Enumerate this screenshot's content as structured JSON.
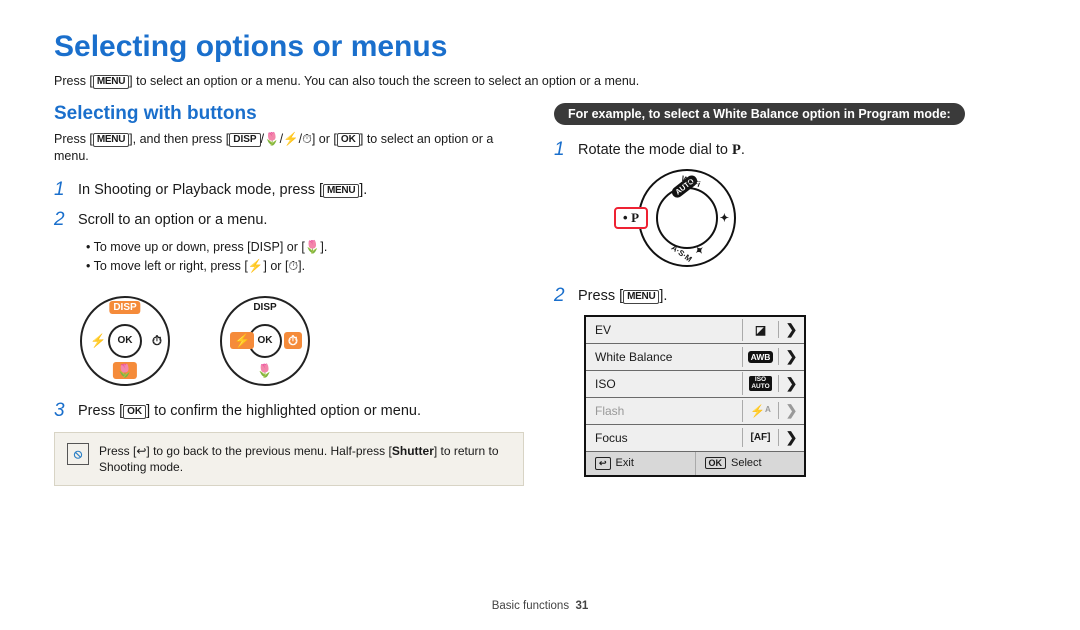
{
  "title": "Selecting options or menus",
  "intro_pre": "Press [",
  "intro_post": "] to select an option or a menu. You can also touch the screen to select an option or a menu.",
  "left": {
    "section_title": "Selecting with buttons",
    "sub_pre": "Press [",
    "sub_mid1": "], and then press [",
    "sub_mid2": "/🌷/⚡/⏱] or [",
    "sub_post": "] to select an option or a menu.",
    "step1_pre": "In Shooting or Playback mode, press [",
    "step1_post": "].",
    "step2": "Scroll to an option or a menu.",
    "bullets": [
      "To move up or down, press [DISP] or [🌷].",
      "To move left or right, press [⚡] or [⏱]."
    ],
    "dpad": {
      "top": "DISP",
      "left": "⚡",
      "right": "⏱",
      "bottom": "🌷",
      "ok": "OK"
    },
    "step3_pre": "Press [",
    "step3_post": "] to confirm the highlighted option or menu.",
    "note_pre": "Press [↩] to go back to the previous menu. Half-press [",
    "note_bold": "Shutter",
    "note_post": "] to return to Shooting mode."
  },
  "right": {
    "example_bar": "For example, to select a White Balance option in Program mode:",
    "step1_pre": "Rotate the mode dial to ",
    "step1_mode": "P",
    "step1_post": ".",
    "dial": {
      "auto": "AUTO",
      "wifi": "Wi-Fi",
      "asm": "A·S·M",
      "p": "P"
    },
    "step2_pre": "Press [",
    "step2_post": "].",
    "menu": {
      "rows": [
        {
          "label": "EV",
          "icon": "◪",
          "dim": false
        },
        {
          "label": "White Balance",
          "icon": "AWB",
          "dim": false,
          "dark": true
        },
        {
          "label": "ISO",
          "icon": "ISO\nAUTO",
          "dim": false,
          "dark": true,
          "small": true
        },
        {
          "label": "Flash",
          "icon": "⚡ᴬ",
          "dim": true
        },
        {
          "label": "Focus",
          "icon": "[AF]",
          "dim": false
        }
      ],
      "footer_exit": "Exit",
      "footer_select": "Select",
      "footer_exit_key": "↩",
      "footer_select_key": "OK"
    }
  },
  "labels": {
    "menu": "MENU",
    "disp": "DISP",
    "ok": "OK"
  },
  "footer": {
    "section": "Basic functions",
    "page": "31"
  }
}
